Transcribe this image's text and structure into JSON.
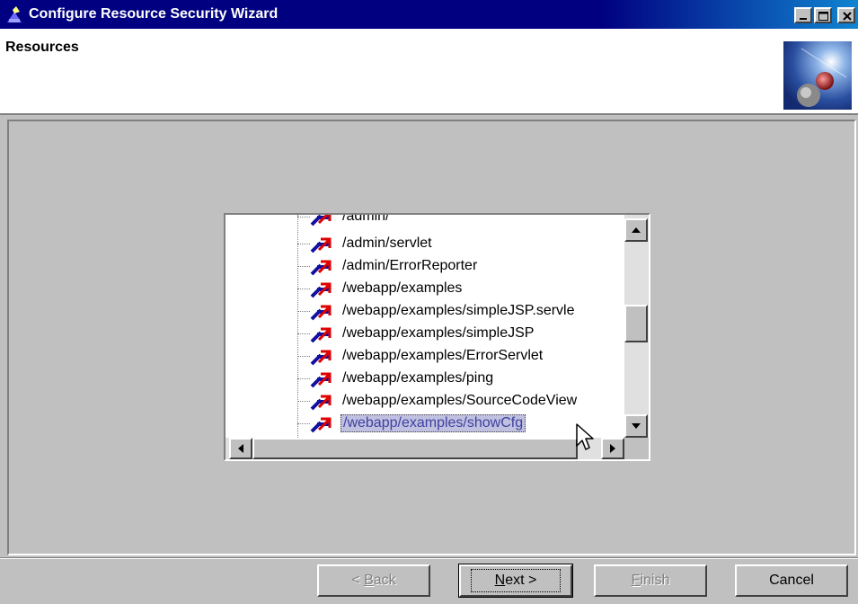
{
  "window": {
    "title": "Configure Resource Security Wizard",
    "header_title": "Resources"
  },
  "tree": {
    "items": [
      {
        "label": "/admin/",
        "selected": false
      },
      {
        "label": "/admin/servlet",
        "selected": false
      },
      {
        "label": "/admin/ErrorReporter",
        "selected": false
      },
      {
        "label": "/webapp/examples",
        "selected": false
      },
      {
        "label": "/webapp/examples/simpleJSP.servle",
        "selected": false
      },
      {
        "label": "/webapp/examples/simpleJSP",
        "selected": false
      },
      {
        "label": "/webapp/examples/ErrorServlet",
        "selected": false
      },
      {
        "label": "/webapp/examples/ping",
        "selected": false
      },
      {
        "label": "/webapp/examples/SourceCodeView",
        "selected": false
      },
      {
        "label": "/webapp/examples/showCfg",
        "selected": true
      }
    ]
  },
  "buttons": {
    "back": {
      "prefix": "< ",
      "mnemonic": "B",
      "rest": "ack",
      "enabled": false
    },
    "next": {
      "mnemonic": "N",
      "rest": "ext >",
      "enabled": true
    },
    "finish": {
      "mnemonic": "F",
      "rest": "inish",
      "enabled": false
    },
    "cancel": {
      "label": "Cancel",
      "enabled": true
    }
  },
  "icons": {
    "app": "wizard-icon",
    "logo": "space-globe-image",
    "tree_item": "resource-arrow-icon"
  },
  "colors": {
    "titlebar": "#000080",
    "selection_bg": "#c0c0e0",
    "selection_text": "#4040a0"
  }
}
